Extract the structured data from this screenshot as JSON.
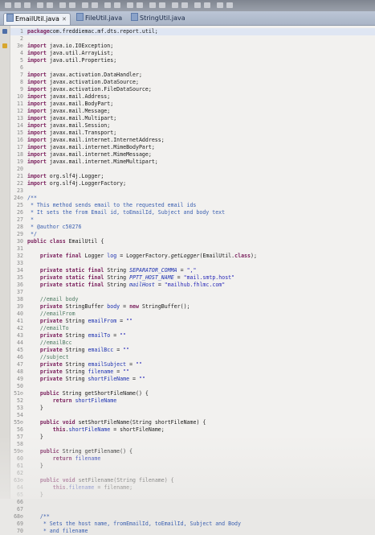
{
  "tabs": [
    {
      "label": "EmailUtil.java",
      "active": true,
      "close": "✕"
    },
    {
      "label": "FileUtil.java",
      "active": false
    },
    {
      "label": "StringUtil.java",
      "active": false
    }
  ],
  "colors": {
    "keyword": "#7a1f5c",
    "comment": "#4d7a62",
    "string": "#2a2ab8",
    "field": "#1a2fb0"
  },
  "code_lines": [
    {
      "n": "1",
      "tokens": [
        [
          "kw",
          "package"
        ],
        [
          "",
          "com.freddiemac.mf.dts.report.util;"
        ]
      ]
    },
    {
      "n": "2",
      "tokens": []
    },
    {
      "n": "3⊕",
      "tokens": [
        [
          "kw",
          "import"
        ],
        [
          "",
          " java.io.IOException;"
        ]
      ]
    },
    {
      "n": "4",
      "tokens": [
        [
          "kw",
          "import"
        ],
        [
          "",
          " java.util.ArrayList;"
        ]
      ]
    },
    {
      "n": "5",
      "tokens": [
        [
          "kw",
          "import"
        ],
        [
          "",
          " java.util.Properties;"
        ]
      ]
    },
    {
      "n": "6",
      "tokens": []
    },
    {
      "n": "7",
      "tokens": [
        [
          "kw",
          "import"
        ],
        [
          "",
          " javax.activation.DataHandler;"
        ]
      ]
    },
    {
      "n": "8",
      "tokens": [
        [
          "kw",
          "import"
        ],
        [
          "",
          " javax.activation.DataSource;"
        ]
      ]
    },
    {
      "n": "9",
      "tokens": [
        [
          "kw",
          "import"
        ],
        [
          "",
          " javax.activation.FileDataSource;"
        ]
      ]
    },
    {
      "n": "10",
      "tokens": [
        [
          "kw",
          "import"
        ],
        [
          "",
          " javax.mail.Address;"
        ]
      ]
    },
    {
      "n": "11",
      "tokens": [
        [
          "kw",
          "import"
        ],
        [
          "",
          " javax.mail.BodyPart;"
        ]
      ]
    },
    {
      "n": "12",
      "tokens": [
        [
          "kw",
          "import"
        ],
        [
          "",
          " javax.mail.Message;"
        ]
      ]
    },
    {
      "n": "13",
      "tokens": [
        [
          "kw",
          "import"
        ],
        [
          "",
          " javax.mail.Multipart;"
        ]
      ]
    },
    {
      "n": "14",
      "tokens": [
        [
          "kw",
          "import"
        ],
        [
          "",
          " javax.mail.Session;"
        ]
      ]
    },
    {
      "n": "15",
      "tokens": [
        [
          "kw",
          "import"
        ],
        [
          "",
          " javax.mail.Transport;"
        ]
      ]
    },
    {
      "n": "16",
      "tokens": [
        [
          "kw",
          "import"
        ],
        [
          "",
          " javax.mail.internet.InternetAddress;"
        ]
      ]
    },
    {
      "n": "17",
      "tokens": [
        [
          "kw",
          "import"
        ],
        [
          "",
          " javax.mail.internet.MimeBodyPart;"
        ]
      ]
    },
    {
      "n": "18",
      "tokens": [
        [
          "kw",
          "import"
        ],
        [
          "",
          " javax.mail.internet.MimeMessage;"
        ]
      ]
    },
    {
      "n": "19",
      "tokens": [
        [
          "kw",
          "import"
        ],
        [
          "",
          " javax.mail.internet.MimeMultipart;"
        ]
      ]
    },
    {
      "n": "20",
      "tokens": []
    },
    {
      "n": "21",
      "tokens": [
        [
          "kw",
          "import"
        ],
        [
          "",
          " org.slf4j.Logger;"
        ]
      ]
    },
    {
      "n": "22",
      "tokens": [
        [
          "kw",
          "import"
        ],
        [
          "",
          " org.slf4j.LoggerFactory;"
        ]
      ]
    },
    {
      "n": "23",
      "tokens": []
    },
    {
      "n": "24⊖",
      "tokens": [
        [
          "jd",
          "/**"
        ]
      ]
    },
    {
      "n": "25",
      "tokens": [
        [
          "jd",
          " * This method sends email to the requested email ids"
        ]
      ]
    },
    {
      "n": "26",
      "tokens": [
        [
          "jd",
          " * It sets the from Email id, toEmailId, Subject and body text"
        ]
      ]
    },
    {
      "n": "27",
      "tokens": [
        [
          "jd",
          " *"
        ]
      ]
    },
    {
      "n": "28",
      "tokens": [
        [
          "jd",
          " * @author c50276"
        ]
      ]
    },
    {
      "n": "29",
      "tokens": [
        [
          "jd",
          " */"
        ]
      ]
    },
    {
      "n": "30",
      "tokens": [
        [
          "kw",
          "public"
        ],
        [
          "",
          " "
        ],
        [
          "kw",
          "class"
        ],
        [
          "",
          " EmailUtil {"
        ]
      ]
    },
    {
      "n": "31",
      "tokens": []
    },
    {
      "n": "32",
      "tokens": [
        [
          "",
          "    "
        ],
        [
          "kw",
          "private"
        ],
        [
          "",
          " "
        ],
        [
          "kw",
          "final"
        ],
        [
          "",
          " Logger "
        ],
        [
          "fld",
          "log"
        ],
        [
          "",
          " = LoggerFactory."
        ],
        [
          "it",
          "getLogger"
        ],
        [
          "",
          "(EmailUtil."
        ],
        [
          "kw",
          "class"
        ],
        [
          "",
          ");"
        ]
      ]
    },
    {
      "n": "33",
      "tokens": []
    },
    {
      "n": "34",
      "tokens": [
        [
          "",
          "    "
        ],
        [
          "kw",
          "private"
        ],
        [
          "",
          " "
        ],
        [
          "kw",
          "static"
        ],
        [
          "",
          " "
        ],
        [
          "kw",
          "final"
        ],
        [
          "",
          " String "
        ],
        [
          "sfld",
          "SEPARATOR_COMMA"
        ],
        [
          "",
          " = "
        ],
        [
          "str",
          "\",\""
        ],
        [
          ";"
        ]
      ]
    },
    {
      "n": "35",
      "tokens": [
        [
          "",
          "    "
        ],
        [
          "kw",
          "private"
        ],
        [
          "",
          " "
        ],
        [
          "kw",
          "static"
        ],
        [
          "",
          " "
        ],
        [
          "kw",
          "final"
        ],
        [
          "",
          " String "
        ],
        [
          "sfld",
          "PPTT_HOST_NAME"
        ],
        [
          "",
          " = "
        ],
        [
          "str",
          "\"mail.smtp.host\""
        ],
        [
          ";"
        ]
      ]
    },
    {
      "n": "36",
      "tokens": [
        [
          "",
          "    "
        ],
        [
          "kw",
          "private"
        ],
        [
          "",
          " "
        ],
        [
          "kw",
          "static"
        ],
        [
          "",
          " "
        ],
        [
          "kw",
          "final"
        ],
        [
          "",
          " String "
        ],
        [
          "sfld",
          "mailHost"
        ],
        [
          "",
          " = "
        ],
        [
          "str",
          "\"mailhub.fhlmc.com\""
        ],
        [
          ";"
        ]
      ]
    },
    {
      "n": "37",
      "tokens": []
    },
    {
      "n": "38",
      "tokens": [
        [
          "cm",
          "    //email body"
        ]
      ]
    },
    {
      "n": "39",
      "tokens": [
        [
          "",
          "    "
        ],
        [
          "kw",
          "private"
        ],
        [
          "",
          " StringBuffer "
        ],
        [
          "fld",
          "body"
        ],
        [
          "",
          " = "
        ],
        [
          "kw",
          "new"
        ],
        [
          "",
          " StringBuffer();"
        ]
      ]
    },
    {
      "n": "40",
      "tokens": [
        [
          "cm",
          "    //emailFrom"
        ]
      ]
    },
    {
      "n": "41",
      "tokens": [
        [
          "",
          "    "
        ],
        [
          "kw",
          "private"
        ],
        [
          "",
          " String "
        ],
        [
          "fld",
          "emailFrom"
        ],
        [
          "",
          " = "
        ],
        [
          "str",
          "\"\""
        ],
        [
          ";"
        ]
      ]
    },
    {
      "n": "42",
      "tokens": [
        [
          "cm",
          "    //emailTo"
        ]
      ]
    },
    {
      "n": "43",
      "tokens": [
        [
          "",
          "    "
        ],
        [
          "kw",
          "private"
        ],
        [
          "",
          " String "
        ],
        [
          "fld",
          "emailTo"
        ],
        [
          "",
          " = "
        ],
        [
          "str",
          "\"\""
        ],
        [
          ";"
        ]
      ]
    },
    {
      "n": "44",
      "tokens": [
        [
          "cm",
          "    //emailBcc"
        ]
      ]
    },
    {
      "n": "45",
      "tokens": [
        [
          "",
          "    "
        ],
        [
          "kw",
          "private"
        ],
        [
          "",
          " String "
        ],
        [
          "fld",
          "emailBcc"
        ],
        [
          "",
          " = "
        ],
        [
          "str",
          "\"\""
        ],
        [
          ";"
        ]
      ]
    },
    {
      "n": "46",
      "tokens": [
        [
          "cm",
          "    //subject"
        ]
      ]
    },
    {
      "n": "47",
      "tokens": [
        [
          "",
          "    "
        ],
        [
          "kw",
          "private"
        ],
        [
          "",
          " String "
        ],
        [
          "fld",
          "emailSubject"
        ],
        [
          "",
          " = "
        ],
        [
          "str",
          "\"\""
        ],
        [
          ";"
        ]
      ]
    },
    {
      "n": "48",
      "tokens": [
        [
          "",
          "    "
        ],
        [
          "kw",
          "private"
        ],
        [
          "",
          " String "
        ],
        [
          "fld",
          "filename"
        ],
        [
          "",
          " = "
        ],
        [
          "str",
          "\"\""
        ],
        [
          ";"
        ]
      ]
    },
    {
      "n": "49",
      "tokens": [
        [
          "",
          "    "
        ],
        [
          "kw",
          "private"
        ],
        [
          "",
          " String "
        ],
        [
          "fld",
          "shortFileName"
        ],
        [
          "",
          " = "
        ],
        [
          "str",
          "\"\""
        ],
        [
          ";"
        ]
      ]
    },
    {
      "n": "50",
      "tokens": []
    },
    {
      "n": "51⊖",
      "tokens": [
        [
          "",
          "    "
        ],
        [
          "kw",
          "public"
        ],
        [
          "",
          " String getShortFileName() {"
        ]
      ]
    },
    {
      "n": "52",
      "tokens": [
        [
          "",
          "        "
        ],
        [
          "kw",
          "return"
        ],
        [
          "",
          " "
        ],
        [
          "fld",
          "shortFileName"
        ],
        [
          ";"
        ]
      ]
    },
    {
      "n": "53",
      "tokens": [
        [
          "",
          "    }"
        ]
      ]
    },
    {
      "n": "54",
      "tokens": []
    },
    {
      "n": "55⊖",
      "tokens": [
        [
          "",
          "    "
        ],
        [
          "kw",
          "public"
        ],
        [
          "",
          " "
        ],
        [
          "kw",
          "void"
        ],
        [
          "",
          " setShortFileName(String shortFileName) {"
        ]
      ]
    },
    {
      "n": "56",
      "tokens": [
        [
          "",
          "        "
        ],
        [
          "kw",
          "this"
        ],
        [
          "",
          "."
        ],
        [
          "fld",
          "shortFileName"
        ],
        [
          "",
          " = shortFileName;"
        ]
      ]
    },
    {
      "n": "57",
      "tokens": [
        [
          "",
          "    }"
        ]
      ]
    },
    {
      "n": "58",
      "tokens": []
    },
    {
      "n": "59⊖",
      "tokens": [
        [
          "",
          "    "
        ],
        [
          "kw",
          "public"
        ],
        [
          "",
          " String getFilename() {"
        ]
      ]
    },
    {
      "n": "60",
      "tokens": [
        [
          "",
          "        "
        ],
        [
          "kw",
          "return"
        ],
        [
          "",
          " "
        ],
        [
          "fld",
          "filename"
        ],
        [
          ";"
        ]
      ]
    },
    {
      "n": "61",
      "tokens": [
        [
          "",
          "    }"
        ]
      ]
    },
    {
      "n": "62",
      "tokens": []
    },
    {
      "n": "63⊖",
      "tokens": [
        [
          "",
          "    "
        ],
        [
          "kw",
          "public"
        ],
        [
          "",
          " "
        ],
        [
          "kw",
          "void"
        ],
        [
          "",
          " setFilename(String filename) {"
        ]
      ]
    },
    {
      "n": "64",
      "tokens": [
        [
          "",
          "        "
        ],
        [
          "kw",
          "this"
        ],
        [
          "",
          "."
        ],
        [
          "fld",
          "filename"
        ],
        [
          "",
          " = filename;"
        ]
      ]
    },
    {
      "n": "65",
      "tokens": [
        [
          "",
          "    }"
        ]
      ]
    },
    {
      "n": "66",
      "tokens": []
    },
    {
      "n": "67",
      "tokens": []
    },
    {
      "n": "68⊖",
      "tokens": [
        [
          "jd",
          "    /**"
        ]
      ]
    },
    {
      "n": "69",
      "tokens": [
        [
          "jd",
          "     * Sets the host name, fromEmailId, toEmailId, Subject and Body"
        ]
      ]
    },
    {
      "n": "70",
      "tokens": [
        [
          "jd",
          "     * and filename"
        ]
      ]
    }
  ]
}
